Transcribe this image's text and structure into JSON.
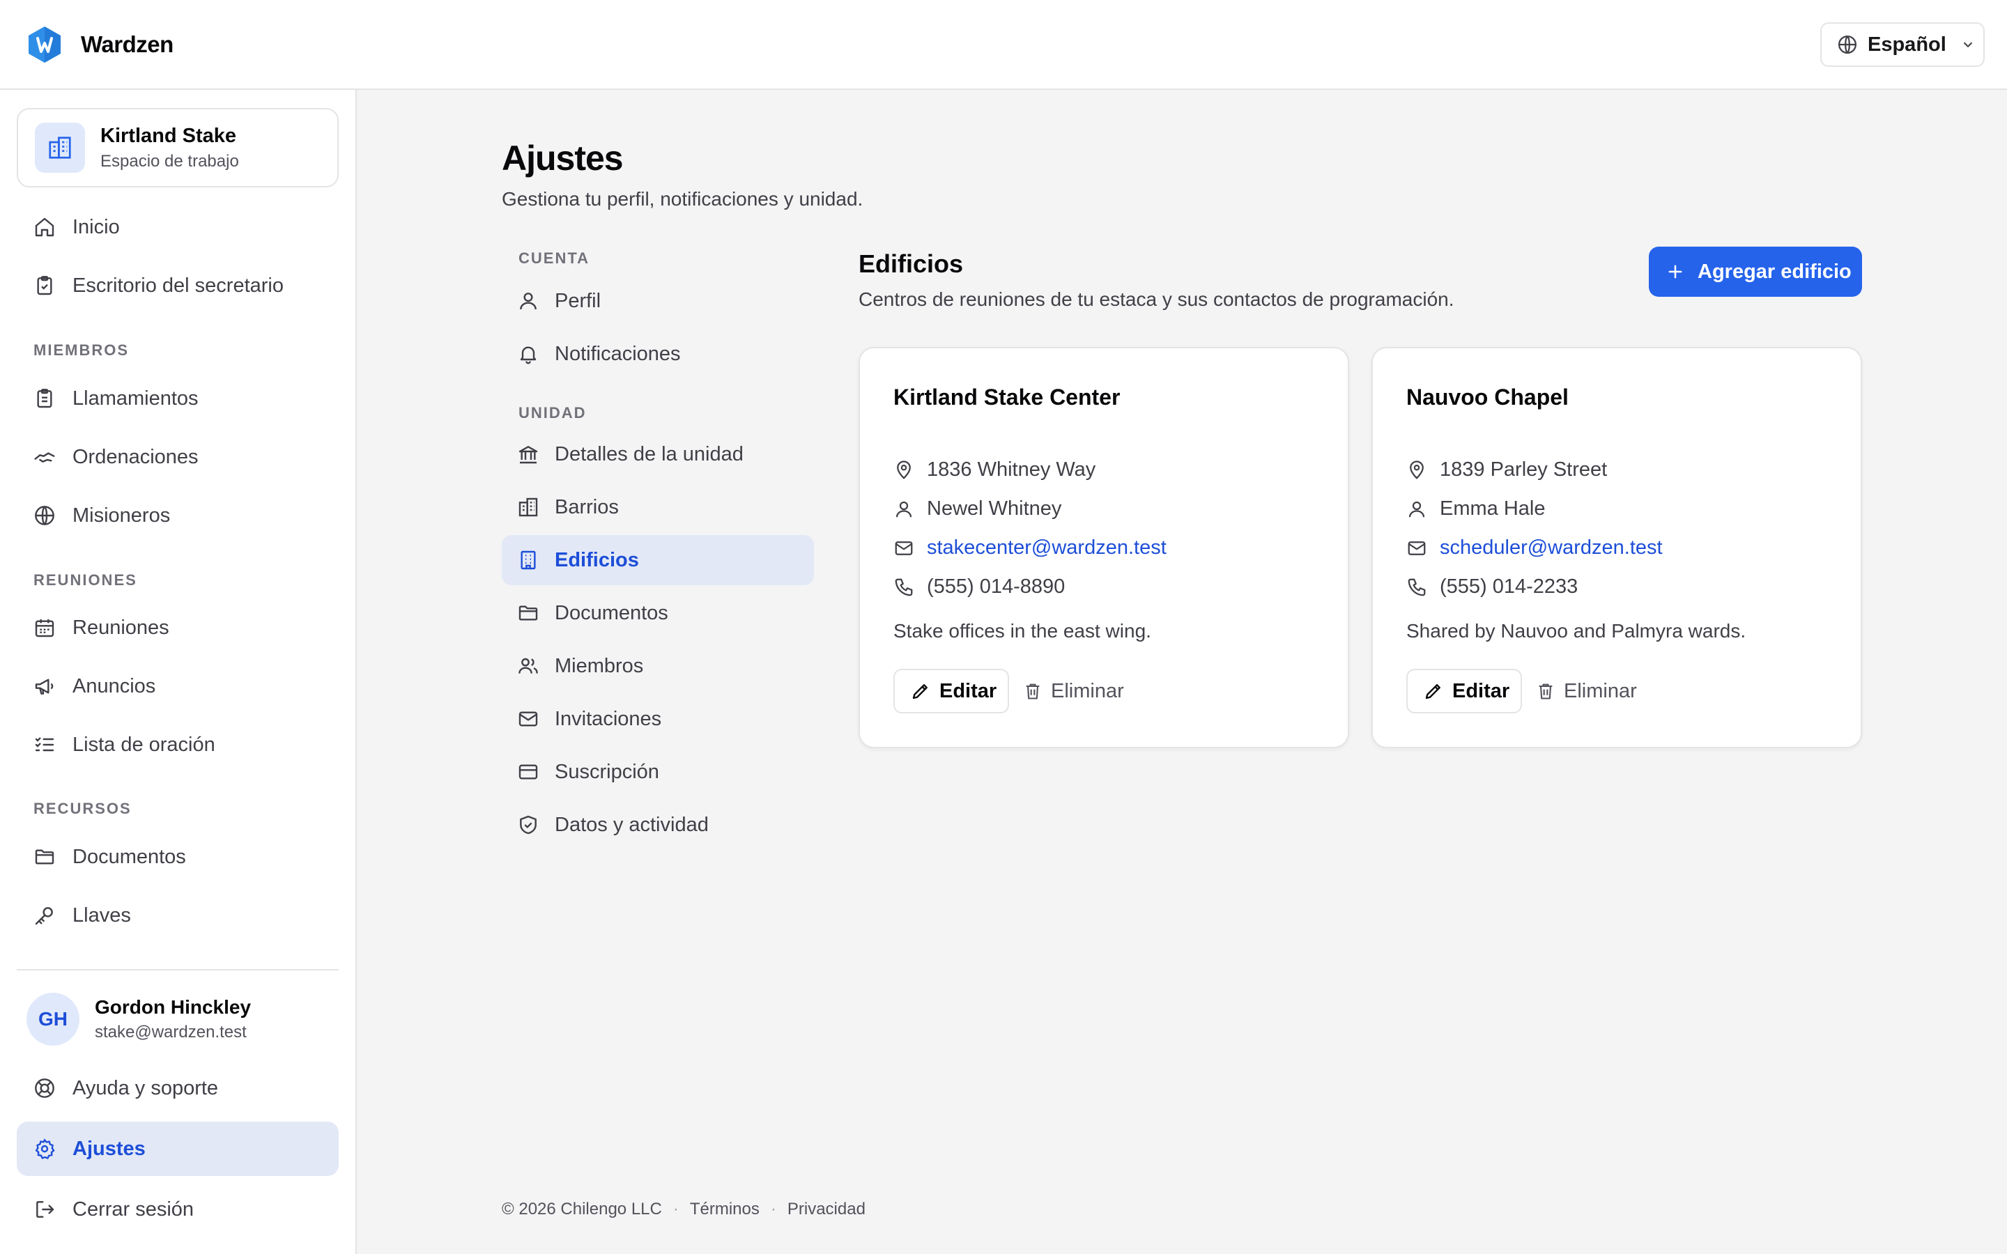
{
  "app": {
    "name": "Wardzen"
  },
  "language": {
    "selected": "Español"
  },
  "workspace": {
    "name": "Kirtland Stake",
    "subtitle": "Espacio de trabajo"
  },
  "sidebar": {
    "top": [
      {
        "label": "Inicio",
        "icon": "home-icon"
      },
      {
        "label": "Escritorio del secretario",
        "icon": "clipboard-icon"
      }
    ],
    "sections": [
      {
        "title": "MIEMBROS",
        "items": [
          {
            "label": "Llamamientos",
            "icon": "clipboard-list-icon"
          },
          {
            "label": "Ordenaciones",
            "icon": "handshake-icon"
          },
          {
            "label": "Misioneros",
            "icon": "globe-icon"
          }
        ]
      },
      {
        "title": "REUNIONES",
        "items": [
          {
            "label": "Reuniones",
            "icon": "calendar-icon"
          },
          {
            "label": "Anuncios",
            "icon": "megaphone-icon"
          },
          {
            "label": "Lista de oración",
            "icon": "list-checks-icon"
          }
        ]
      },
      {
        "title": "RECURSOS",
        "items": [
          {
            "label": "Documentos",
            "icon": "folder-icon"
          },
          {
            "label": "Llaves",
            "icon": "key-icon"
          }
        ]
      }
    ],
    "user": {
      "initials": "GH",
      "name": "Gordon Hinckley",
      "email": "stake@wardzen.test"
    },
    "bottom": [
      {
        "label": "Ayuda y soporte",
        "icon": "lifebuoy-icon"
      },
      {
        "label": "Ajustes",
        "icon": "gear-icon",
        "active": true
      },
      {
        "label": "Cerrar sesión",
        "icon": "logout-icon"
      }
    ]
  },
  "page": {
    "title": "Ajustes",
    "subtitle": "Gestiona tu perfil, notificaciones y unidad."
  },
  "settings_nav": {
    "account_label": "CUENTA",
    "account_items": [
      {
        "label": "Perfil",
        "icon": "user-icon"
      },
      {
        "label": "Notificaciones",
        "icon": "bell-icon"
      }
    ],
    "unit_label": "UNIDAD",
    "unit_items": [
      {
        "label": "Detalles de la unidad",
        "icon": "landmark-icon"
      },
      {
        "label": "Barrios",
        "icon": "buildings-icon"
      },
      {
        "label": "Edificios",
        "icon": "building-icon",
        "active": true
      },
      {
        "label": "Documentos",
        "icon": "folder-icon"
      },
      {
        "label": "Miembros",
        "icon": "users-icon"
      },
      {
        "label": "Invitaciones",
        "icon": "mail-icon"
      },
      {
        "label": "Suscripción",
        "icon": "credit-card-icon"
      },
      {
        "label": "Datos y actividad",
        "icon": "shield-check-icon"
      }
    ]
  },
  "buildings_section": {
    "title": "Edificios",
    "subtitle": "Centros de reuniones de tu estaca y sus contactos de programación.",
    "add_label": "Agregar edificio",
    "edit_label": "Editar",
    "delete_label": "Eliminar",
    "buildings": [
      {
        "name": "Kirtland Stake Center",
        "address": "1836 Whitney Way",
        "contact": "Newel Whitney",
        "email": "stakecenter@wardzen.test",
        "phone": "(555) 014-8890",
        "note": "Stake offices in the east wing."
      },
      {
        "name": "Nauvoo Chapel",
        "address": "1839 Parley Street",
        "contact": "Emma Hale",
        "email": "scheduler@wardzen.test",
        "phone": "(555) 014-2233",
        "note": "Shared by Nauvoo and Palmyra wards."
      }
    ]
  },
  "footer": {
    "copyright": "© 2026 Chilengo LLC",
    "terms": "Términos",
    "privacy": "Privacidad"
  },
  "colors": {
    "accent": "#2563eb",
    "active_bg": "#e2e8f6",
    "link": "#1d4ed8"
  }
}
